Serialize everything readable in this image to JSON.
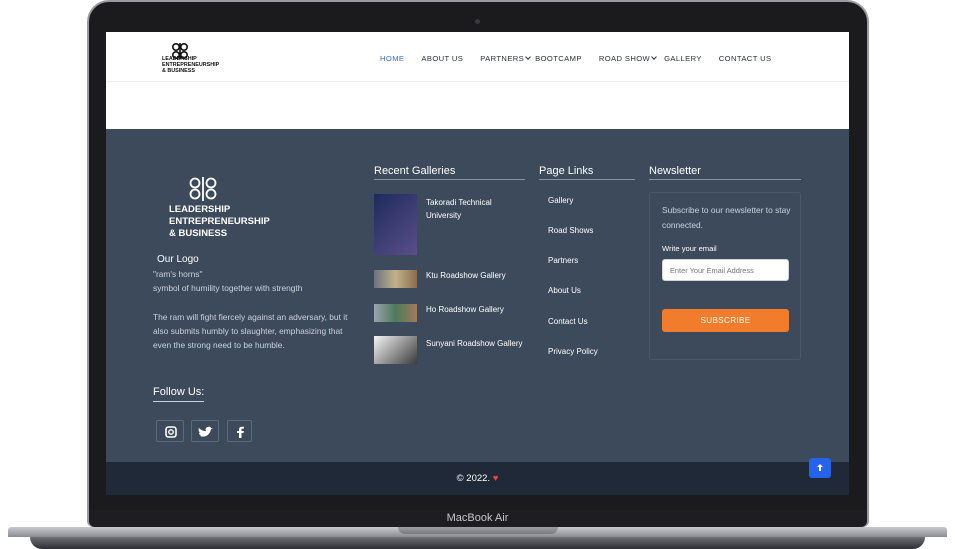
{
  "device": {
    "label": "MacBook Air"
  },
  "header": {
    "logo_text": "LEADERSHIP ENTREPRENEURSHIP & BUSINESS",
    "nav": [
      {
        "label": "HOME",
        "active": true
      },
      {
        "label": "ABOUT US"
      },
      {
        "label": "PARTNERS",
        "dropdown": true
      },
      {
        "label": "BOOTCAMP"
      },
      {
        "label": "ROAD SHOW",
        "dropdown": true
      },
      {
        "label": "GALLERY"
      },
      {
        "label": "CONTACT US"
      }
    ]
  },
  "footer": {
    "logo": {
      "line1": "LEADERSHIP",
      "line2": "ENTREPRENEURSHIP",
      "line3": "& BUSINESS",
      "caption": "Our Logo",
      "desc1": "\"ram's horns\"",
      "desc2": "symbol of humility together with strength",
      "desc3": "The ram will fight fiercely against an adversary, but it also submits humbly to slaughter, emphasizing that even the strong need to be humble."
    },
    "follow": {
      "title": "Follow Us:",
      "icons": [
        "instagram-icon",
        "twitter-icon",
        "facebook-icon"
      ]
    },
    "galleries": {
      "title": "Recent Galleries",
      "items": [
        "Takoradi Technical University",
        "Ktu Roadshow Gallery",
        "Ho Roadshow Gallery",
        "Sunyani Roadshow Gallery"
      ]
    },
    "links": {
      "title": "Page Links",
      "items": [
        "Gallery",
        "Road Shows",
        "Partners",
        "About Us",
        "Contact Us",
        "Privacy Policy"
      ]
    },
    "newsletter": {
      "title": "Newsletter",
      "text": "Subscribe to our newsletter to stay connected.",
      "email_label": "Write your email",
      "placeholder": "Enter Your Email Address",
      "button": "SUBSCRIBE"
    },
    "copyright": "© 2022.",
    "colors": {
      "accent": "#f07c2c",
      "footer_bg": "#3d4a5c",
      "nav_active": "#3b6ad8",
      "heart": "#ef4444"
    }
  }
}
